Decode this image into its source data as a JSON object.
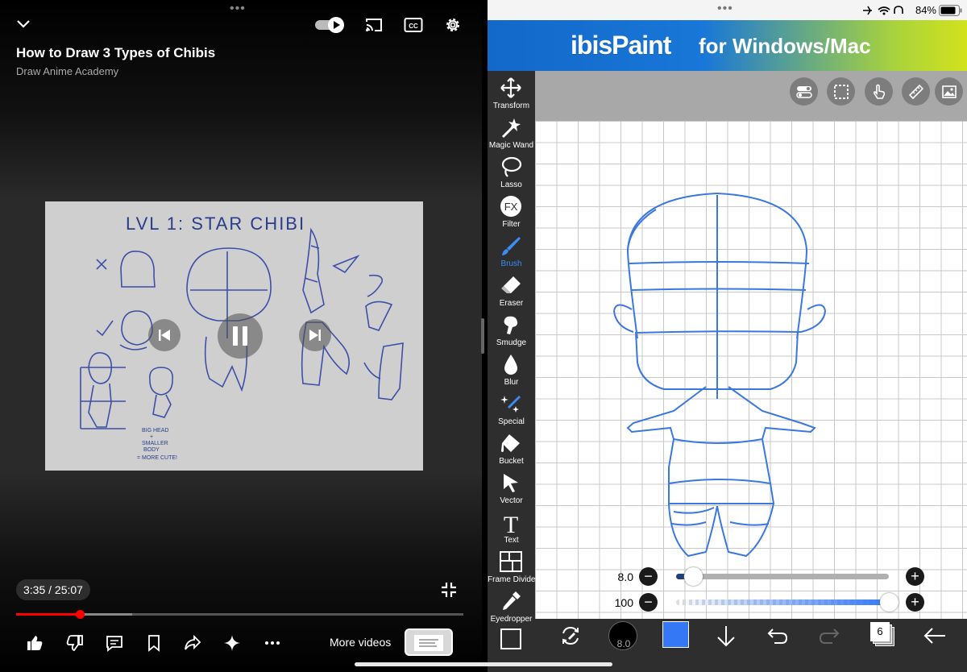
{
  "player": {
    "title": "How to Draw 3 Types of Chibis",
    "channel": "Draw Anime Academy",
    "current_time": "3:35 / 25:07",
    "progress_fraction": 0.143,
    "more_videos_label": "More videos",
    "video": {
      "heading": "LVL 1: STAR CHIBI",
      "note_lines": [
        "BIG HEAD",
        "+",
        "SMALLER",
        "BODY",
        "= MORE CUTE!"
      ]
    },
    "top_icons": [
      "chevron-down-icon",
      "autoplay-toggle-icon",
      "cast-icon",
      "captions-icon",
      "settings-gear-icon"
    ],
    "bottom_icons": [
      "like-icon",
      "dislike-icon",
      "comments-icon",
      "save-icon",
      "share-icon",
      "sparkle-icon",
      "more-icon"
    ],
    "accent_color": "#ff0000"
  },
  "ipad_status": {
    "battery": "84%"
  },
  "ibis": {
    "banner_logo": "ibisPaint",
    "banner_tagline": "for Windows/Mac",
    "tools": [
      {
        "label": "Transform",
        "icon": "transform-icon"
      },
      {
        "label": "Magic Wand",
        "icon": "magic-wand-icon"
      },
      {
        "label": "Lasso",
        "icon": "lasso-icon"
      },
      {
        "label": "Filter",
        "icon": "filter-icon"
      },
      {
        "label": "Brush",
        "icon": "brush-icon"
      },
      {
        "label": "Eraser",
        "icon": "eraser-icon"
      },
      {
        "label": "Smudge",
        "icon": "smudge-icon"
      },
      {
        "label": "Blur",
        "icon": "blur-icon"
      },
      {
        "label": "Special",
        "icon": "special-icon"
      },
      {
        "label": "Bucket",
        "icon": "bucket-icon"
      },
      {
        "label": "Vector",
        "icon": "vector-icon"
      },
      {
        "label": "Text",
        "icon": "text-icon"
      },
      {
        "label": "Frame Divider",
        "icon": "frame-divider-icon"
      },
      {
        "label": "Eyedropper",
        "icon": "eyedropper-icon"
      }
    ],
    "active_tool": "Brush",
    "filter_glyph": "FX",
    "text_glyph": "T",
    "brush_size": "8.0",
    "brush_opacity": "100",
    "brush_size_fraction": 0.08,
    "brush_opacity_fraction": 1.0,
    "layer_count": "6",
    "brush_color": "#3478f6",
    "stroke_color": "#3a78e0"
  }
}
